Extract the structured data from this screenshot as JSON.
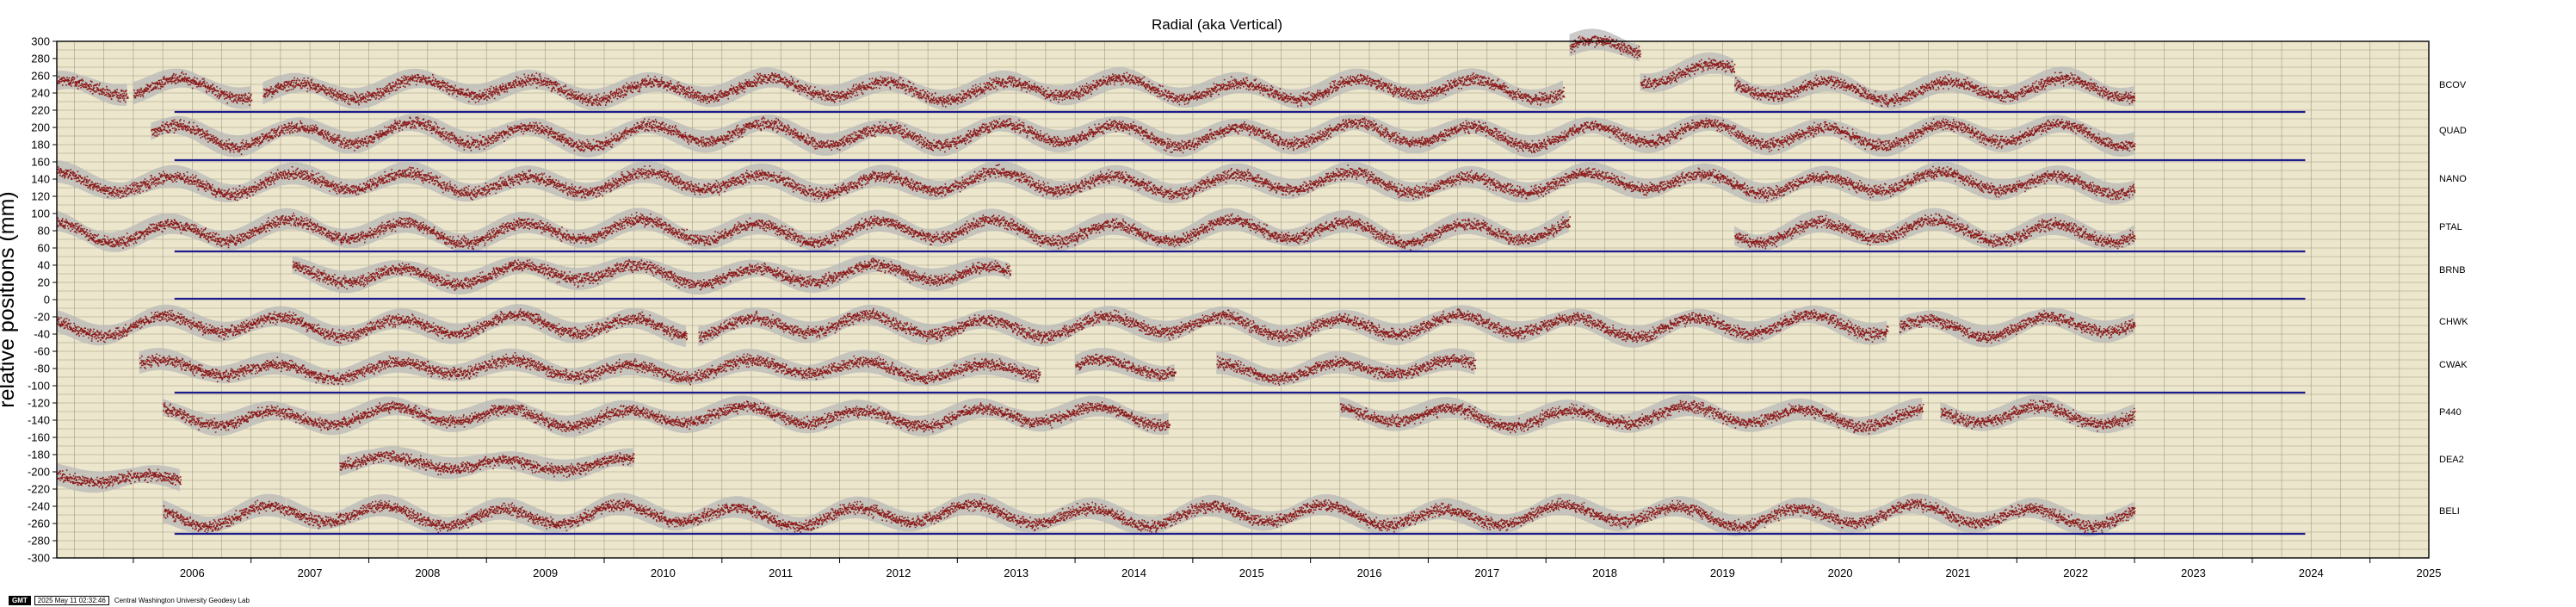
{
  "chart_data": {
    "type": "scatter",
    "title": "Radial (aka Vertical)",
    "ylabel": "relative positions (mm)",
    "xlabel": "",
    "xlim": [
      2005.35,
      2025.5
    ],
    "ylim": [
      -300,
      300
    ],
    "yticks": [
      "300",
      "280",
      "260",
      "240",
      "220",
      "200",
      "180",
      "160",
      "140",
      "120",
      "100",
      "80",
      "60",
      "40",
      "20",
      "0",
      "-20",
      "-40",
      "-60",
      "-80",
      "-100",
      "-120",
      "-140",
      "-160",
      "-180",
      "-200",
      "-220",
      "-240",
      "-260",
      "-280",
      "-300"
    ],
    "xticks": [
      "2006",
      "2007",
      "2008",
      "2009",
      "2010",
      "2011",
      "2012",
      "2013",
      "2014",
      "2015",
      "2016",
      "2017",
      "2018",
      "2019",
      "2020",
      "2021",
      "2022",
      "2023",
      "2024",
      "2025"
    ],
    "grid": true,
    "background_color": "#ece6cc",
    "point_color": "#8b1a1a",
    "uncertainty_color": "#b8b8b8",
    "reference_line_color": "#1c1c8c",
    "series": [
      {
        "name": "BCOV",
        "offset": 245,
        "amplitude": 10,
        "segments": [
          [
            2005.35,
            2005.95
          ],
          [
            2006.0,
            2007.0
          ],
          [
            2007.1,
            2018.15
          ],
          [
            2018.8,
            2019.6
          ],
          [
            2019.6,
            2023.0
          ]
        ],
        "levels": [
          {
            "range": [
              2018.2,
              2018.8
            ],
            "offset": 295
          },
          {
            "range": [
              2018.8,
              2019.6
            ],
            "offset": 262
          }
        ]
      },
      {
        "name": "QUAD",
        "offset": 192,
        "amplitude": 11,
        "segments": [
          [
            2006.15,
            2023.0
          ]
        ]
      },
      {
        "name": "NANO",
        "offset": 136,
        "amplitude": 10,
        "segments": [
          [
            2005.35,
            2023.0
          ]
        ]
      },
      {
        "name": "PTAL",
        "offset": 80,
        "amplitude": 11,
        "segments": [
          [
            2005.35,
            2018.2
          ],
          [
            2019.6,
            2023.0
          ]
        ]
      },
      {
        "name": "BRNB",
        "offset": 30,
        "amplitude": 9,
        "segments": [
          [
            2007.35,
            2013.45
          ]
        ]
      },
      {
        "name": "CHWK",
        "offset": -30,
        "amplitude": 10,
        "segments": [
          [
            2005.35,
            2010.7
          ],
          [
            2010.8,
            2020.9
          ],
          [
            2021.0,
            2023.0
          ]
        ]
      },
      {
        "name": "CWAK",
        "offset": -80,
        "amplitude": 8,
        "segments": [
          [
            2006.05,
            2013.7
          ],
          [
            2014.0,
            2014.85
          ],
          [
            2015.2,
            2017.4
          ]
        ]
      },
      {
        "name": "P440",
        "offset": -135,
        "amplitude": 9,
        "segments": [
          [
            2006.25,
            2014.8
          ],
          [
            2016.25,
            2021.2
          ],
          [
            2021.35,
            2023.0
          ]
        ]
      },
      {
        "name": "DEA2",
        "offset": -190,
        "amplitude": 6,
        "segments": [
          [
            2007.75,
            2009.9
          ],
          [
            2009.9,
            2010.25
          ]
        ],
        "levels": [
          {
            "range": [
              2005.35,
              2006.4
            ],
            "offset": -208
          }
        ]
      },
      {
        "name": "BELI",
        "offset": -250,
        "amplitude": 10,
        "segments": [
          [
            2006.25,
            2007.3
          ],
          [
            2007.3,
            2023.0
          ]
        ]
      }
    ],
    "reference_lines": [
      {
        "y": 218,
        "x": [
          2006.35,
          2024.45
        ]
      },
      {
        "y": 162,
        "x": [
          2006.35,
          2024.45
        ]
      },
      {
        "y": 56,
        "x": [
          2006.35,
          2024.45
        ]
      },
      {
        "y": 1,
        "x": [
          2006.35,
          2024.45
        ]
      },
      {
        "y": -108,
        "x": [
          2006.35,
          2024.45
        ]
      },
      {
        "y": -272,
        "x": [
          2006.35,
          2024.45
        ]
      }
    ]
  },
  "footer": {
    "logo": "GMT",
    "timestamp": "2025 May 11 02:32:46",
    "credit": "Central Washington University Geodesy Lab"
  }
}
